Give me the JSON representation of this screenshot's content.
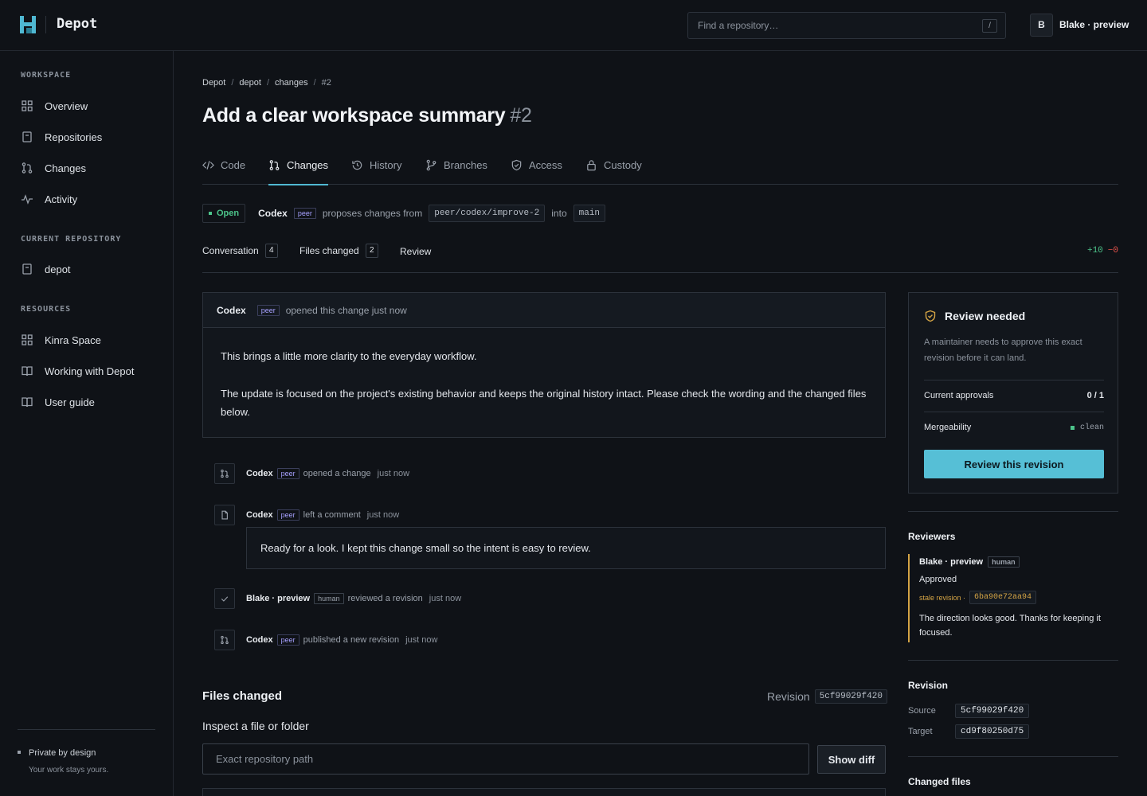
{
  "app": {
    "name": "Depot"
  },
  "search": {
    "placeholder": "Find a repository…",
    "shortcut": "/"
  },
  "user": {
    "initial": "B",
    "name": "Blake · preview"
  },
  "sidebar": {
    "workspace_heading": "WORKSPACE",
    "workspace_items": [
      {
        "label": "Overview",
        "icon": "grid-icon"
      },
      {
        "label": "Repositories",
        "icon": "repo-icon"
      },
      {
        "label": "Changes",
        "icon": "pull-request-icon"
      },
      {
        "label": "Activity",
        "icon": "pulse-icon"
      }
    ],
    "repo_heading": "CURRENT REPOSITORY",
    "repo_items": [
      {
        "label": "depot",
        "icon": "repo-icon"
      }
    ],
    "resources_heading": "RESOURCES",
    "resource_items": [
      {
        "label": "Kinra Space",
        "icon": "grid-icon"
      },
      {
        "label": "Working with Depot",
        "icon": "book-icon"
      },
      {
        "label": "User guide",
        "icon": "book-icon"
      }
    ],
    "footer_title": "Private by design",
    "footer_sub": "Your work stays yours."
  },
  "breadcrumb": [
    "Depot",
    "depot",
    "changes",
    "#2"
  ],
  "page": {
    "title": "Add a clear workspace summary",
    "number": "#2"
  },
  "tabs": [
    {
      "label": "Code",
      "icon": "code-icon"
    },
    {
      "label": "Changes",
      "icon": "pull-request-icon",
      "active": true
    },
    {
      "label": "History",
      "icon": "history-icon"
    },
    {
      "label": "Branches",
      "icon": "branch-icon"
    },
    {
      "label": "Access",
      "icon": "shield-icon"
    },
    {
      "label": "Custody",
      "icon": "lock-icon"
    }
  ],
  "status": {
    "state": "Open",
    "author": "Codex",
    "author_tag": "peer",
    "text_proposes": "proposes changes from",
    "source_branch": "peer/codex/improve-2",
    "text_into": "into",
    "target_branch": "main"
  },
  "subtabs": {
    "conversation": "Conversation",
    "conversation_count": "4",
    "files": "Files changed",
    "files_count": "2",
    "review": "Review",
    "additions": "+10",
    "deletions": "−0"
  },
  "opening": {
    "author": "Codex",
    "tag": "peer",
    "action": "opened this change just now",
    "para1": "This brings a little more clarity to the everyday workflow.",
    "para2": "The update is focused on the project's existing behavior and keeps the original history intact. Please check the wording and the changed files below."
  },
  "timeline": [
    {
      "author": "Codex",
      "tag": "peer",
      "action": "opened a change",
      "time": "just now",
      "icon": "pull-request-icon"
    },
    {
      "author": "Codex",
      "tag": "peer",
      "action": "left a comment",
      "time": "just now",
      "icon": "comment-icon"
    },
    {
      "author": "Blake · preview",
      "tag": "human",
      "action": "reviewed a revision",
      "time": "just now",
      "icon": "check-icon"
    },
    {
      "author": "Codex",
      "tag": "peer",
      "action": "published a new revision",
      "time": "just now",
      "icon": "pull-request-icon"
    }
  ],
  "comment": {
    "text": "Ready for a look. I kept this change small so the intent is easy to review."
  },
  "files_changed": {
    "title": "Files changed",
    "revision_label": "Revision",
    "revision": "5cf99029f420",
    "inspect_label": "Inspect a file or folder",
    "path_placeholder": "Exact repository path",
    "show_diff": "Show diff"
  },
  "review_needed": {
    "title": "Review needed",
    "desc": "A maintainer needs to approve this exact revision before it can land.",
    "approvals_label": "Current approvals",
    "approvals_value": "0 / 1",
    "merge_label": "Mergeability",
    "merge_value": "clean",
    "button": "Review this revision"
  },
  "reviewers": {
    "heading": "Reviewers",
    "name": "Blake · preview",
    "tag": "human",
    "state": "Approved",
    "stale_label": "stale revision ·",
    "stale_rev": "6ba90e72aa94",
    "note": "The direction looks good. Thanks for keeping it focused."
  },
  "revision": {
    "heading": "Revision",
    "source_label": "Source",
    "source": "5cf99029f420",
    "target_label": "Target",
    "target": "cd9f80250d75"
  },
  "changed_files": {
    "heading": "Changed files"
  },
  "colors": {
    "accent": "#56bfd6",
    "open": "#4cc38a",
    "stale": "#d4a445",
    "peer": "#a6a0ff"
  }
}
